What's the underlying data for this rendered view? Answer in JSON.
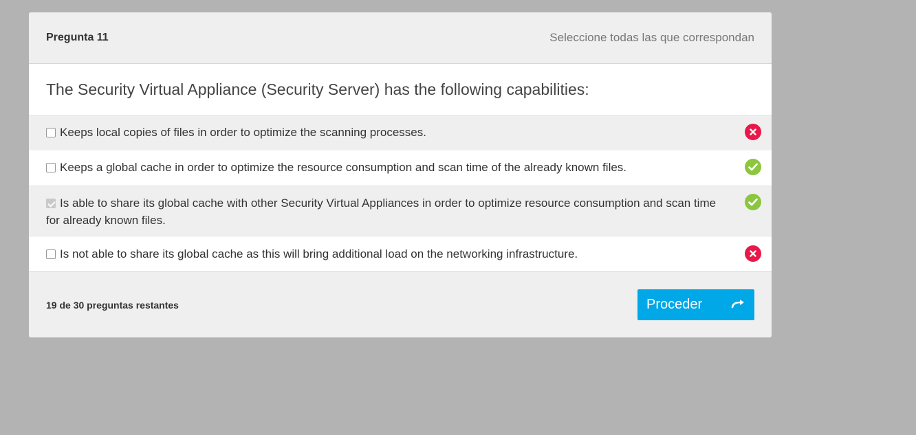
{
  "header": {
    "question_number": "Pregunta 11",
    "hint": "Seleccione todas las que correspondan"
  },
  "question": {
    "text": "The Security Virtual Appliance (Security Server) has the following capabilities:"
  },
  "options": [
    {
      "text": "Keeps local copies of files in order to optimize the scanning processes.",
      "checked": false,
      "status": "wrong",
      "status_icon": "x-circle-icon"
    },
    {
      "text": "Keeps a global cache in order to optimize the resource consumption and scan time of the already known files.",
      "checked": false,
      "status": "correct",
      "status_icon": "check-circle-icon"
    },
    {
      "text": "Is able to share its global cache with other Security Virtual Appliances in order to optimize resource consumption and scan time for already known files.",
      "checked": true,
      "status": "correct",
      "status_icon": "check-circle-icon"
    },
    {
      "text": "Is not able to share its global cache as this will bring additional load on the networking infrastructure.",
      "checked": false,
      "status": "wrong",
      "status_icon": "x-circle-icon"
    }
  ],
  "footer": {
    "remaining": "19 de 30 preguntas restantes",
    "proceed_label": "Proceder",
    "proceed_icon": "arrow-right-curved-icon"
  },
  "colors": {
    "page_background": "#b3b3b3",
    "accent": "#00a8e8",
    "wrong": "#e8194a",
    "correct": "#8cc63f"
  }
}
